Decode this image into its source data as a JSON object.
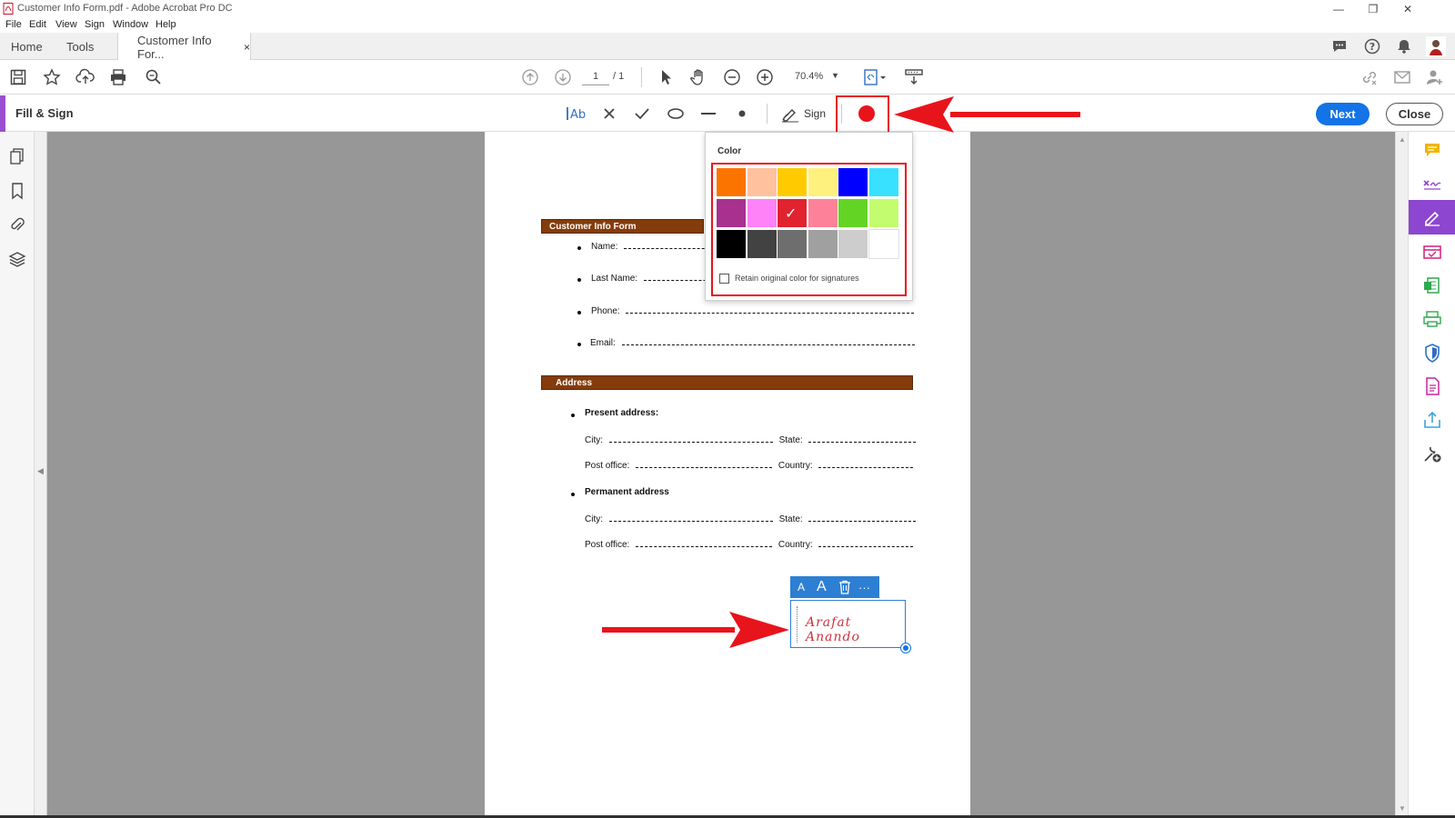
{
  "window": {
    "title": "Customer Info Form.pdf - Adobe Acrobat Pro DC"
  },
  "menu": [
    "File",
    "Edit",
    "View",
    "Sign",
    "Window",
    "Help"
  ],
  "tabs": {
    "home": "Home",
    "tools": "Tools",
    "document": "Customer Info For...",
    "close": "×"
  },
  "toolbar": {
    "page_current": "1",
    "page_total": "/ 1",
    "zoom": "70.4%"
  },
  "fill_sign": {
    "label": "Fill & Sign",
    "sign_label": "Sign",
    "next_label": "Next",
    "close_label": "Close",
    "current_color": "#e8141c"
  },
  "color_popup": {
    "title": "Color",
    "colors": [
      [
        "#fc7400",
        "#ffc19e",
        "#ffcb00",
        "#fef17e",
        "#0000ff",
        "#37e1ff"
      ],
      [
        "#a8318f",
        "#ff82f8",
        "#e0232e",
        "#fd8299",
        "#64d424",
        "#c3fc6e"
      ],
      [
        "#000000",
        "#424242",
        "#6e6e6e",
        "#a0a0a0",
        "#cdcdcd",
        "#ffffff"
      ]
    ],
    "selected": "#e0232e",
    "retain_label": "Retain original color for signatures"
  },
  "document": {
    "section1_title": "Customer Info Form",
    "name_label": "Name:",
    "last_name_label": "Last Name:",
    "phone_label": "Phone:",
    "email_label": "Email:",
    "section2_title": "Address",
    "present_address": "Present address:",
    "permanent_address": "Permanent address",
    "city_label": "City:",
    "state_label": "State:",
    "post_office_label": "Post office:",
    "country_label": "Country:"
  },
  "signature": {
    "text": "Arafat Anando",
    "tool_small_a": "A",
    "tool_large_a": "A",
    "tool_more": "···"
  },
  "icons": {
    "left_nav": [
      "pages-icon",
      "bookmark-icon",
      "attachment-icon",
      "layers-icon"
    ],
    "right_panel": [
      "comment-icon",
      "fill-sign-icon",
      "sign-icon",
      "organize-icon",
      "export-icon",
      "print-production-icon",
      "protect-icon",
      "create-pdf-icon",
      "share-icon",
      "tools-more-icon"
    ]
  }
}
